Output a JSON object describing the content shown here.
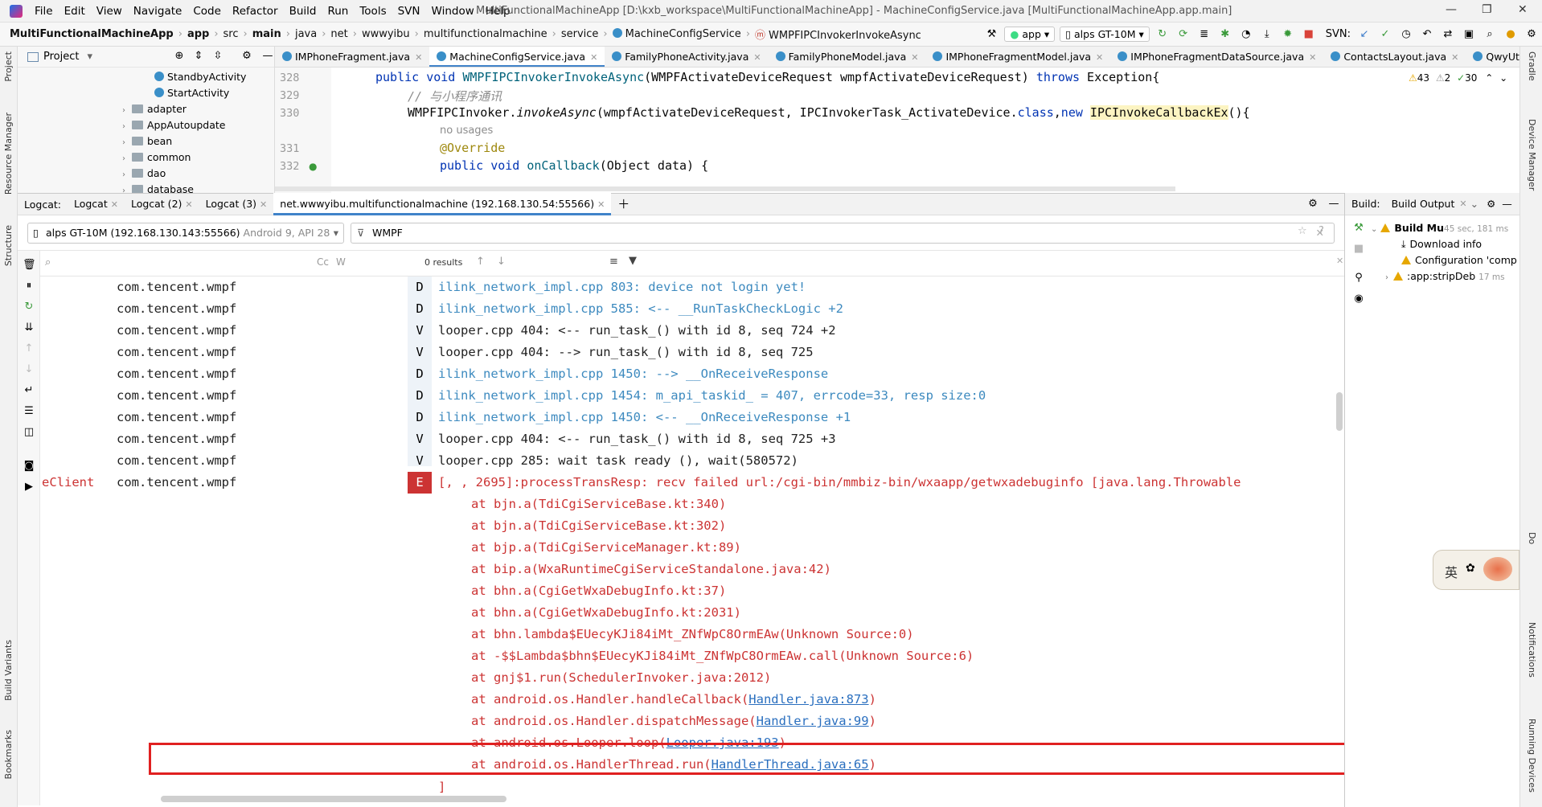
{
  "menubar": {
    "items": [
      "File",
      "Edit",
      "View",
      "Navigate",
      "Code",
      "Refactor",
      "Build",
      "Run",
      "Tools",
      "SVN",
      "Window",
      "Help"
    ],
    "window_title": "MultiFunctionalMachineApp [D:\\kxb_workspace\\MultiFunctionalMachineApp] - MachineConfigService.java [MultiFunctionalMachineApp.app.main]"
  },
  "navbar": {
    "crumbs": [
      "MultiFunctionalMachineApp",
      "app",
      "src",
      "main",
      "java",
      "net",
      "wwwyibu",
      "multifunctionalmachine",
      "service",
      "MachineConfigService",
      "WMPFIPCInvokerInvokeAsync"
    ],
    "run_config": "app",
    "device": "alps GT-10M",
    "svn_label": "SVN:"
  },
  "project": {
    "title": "Project",
    "items": [
      {
        "label": "StandbyActivity",
        "type": "class"
      },
      {
        "label": "StartActivity",
        "type": "class"
      },
      {
        "label": "adapter",
        "type": "folder"
      },
      {
        "label": "AppAutoupdate",
        "type": "folder"
      },
      {
        "label": "bean",
        "type": "folder"
      },
      {
        "label": "common",
        "type": "folder"
      },
      {
        "label": "dao",
        "type": "folder"
      },
      {
        "label": "database",
        "type": "folder"
      }
    ]
  },
  "editor_tabs": [
    "IMPhoneFragment.java",
    "MachineConfigService.java",
    "FamilyPhoneActivity.java",
    "FamilyPhoneModel.java",
    "IMPhoneFragmentModel.java",
    "IMPhoneFragmentDataSource.java",
    "ContactsLayout.java",
    "QwyUtil.java"
  ],
  "editor": {
    "lines": [
      "328",
      "329",
      "330",
      "331",
      "332"
    ],
    "inspections": {
      "warnings": "43",
      "weak": "2",
      "ok": "30"
    },
    "code_lines": {
      "l1_a": "public void ",
      "l1_b": "WMPFIPCInvokerInvokeAsync",
      "l1_c": "(WMPFActivateDeviceRequest wmpfActivateDeviceRequest) ",
      "l1_d": "throws",
      "l1_e": " Exception{",
      "l2": "// 与小程序通讯",
      "l3_a": "WMPFIPCInvoker.",
      "l3_b": "invokeAsync",
      "l3_c": "(wmpfActivateDeviceRequest, IPCInvokerTask_ActivateDevice.",
      "l3_d": "class",
      "l3_e": ",",
      "l3_f": "new ",
      "l3_g": "IPCInvokeCallbackEx",
      "l3_h": "(){",
      "hint": "no usages",
      "l4": "@Override",
      "l5_a": "public void ",
      "l5_b": "onCallback",
      "l5_c": "(Object data) {"
    }
  },
  "logcat": {
    "label": "Logcat:",
    "tabs": [
      "Logcat",
      "Logcat (2)",
      "Logcat (3)",
      "net.wwwyibu.multifunctionalmachine (192.168.130.54:55566)"
    ],
    "device": "alps GT-10M (192.168.130.143:55566)",
    "device_suffix": "Android 9, API 28",
    "filter": "WMPF",
    "results": "0 results",
    "lines": [
      {
        "tag": "com.tencent.wmpf",
        "level": "D",
        "msg": "ilink_network_impl.cpp 803: device not login yet!"
      },
      {
        "tag": "com.tencent.wmpf",
        "level": "D",
        "msg": "ilink_network_impl.cpp 585: <-- __RunTaskCheckLogic +2"
      },
      {
        "tag": "com.tencent.wmpf",
        "level": "V",
        "msg": "looper.cpp 404: <-- run_task_() with id 8, seq 724 +2"
      },
      {
        "tag": "com.tencent.wmpf",
        "level": "V",
        "msg": "looper.cpp 404: --> run_task_() with id 8, seq 725"
      },
      {
        "tag": "com.tencent.wmpf",
        "level": "D",
        "msg": "ilink_network_impl.cpp 1450: --> __OnReceiveResponse"
      },
      {
        "tag": "com.tencent.wmpf",
        "level": "D",
        "msg": "ilink_network_impl.cpp 1454: m_api_taskid_ = 407, errcode=33, resp size:0"
      },
      {
        "tag": "com.tencent.wmpf",
        "level": "D",
        "msg": "ilink_network_impl.cpp 1450: <-- __OnReceiveResponse +1"
      },
      {
        "tag": "com.tencent.wmpf",
        "level": "V",
        "msg": "looper.cpp 404: <-- run_task_() with id 8, seq 725 +3"
      },
      {
        "tag": "com.tencent.wmpf",
        "level": "V",
        "msg": "looper.cpp 285: wait task ready (), wait(580572)"
      },
      {
        "prefix": "eClient",
        "tag": "com.tencent.wmpf",
        "level": "E",
        "msg": "[, , 2695]:processTransResp: recv failed url:/cgi-bin/mmbiz-bin/wxaapp/getwxadebuginfo [java.lang.Throwable"
      }
    ],
    "trace": [
      {
        "text": "at bjn.a(TdiCgiServiceBase.kt:340)"
      },
      {
        "text": "at bjn.a(TdiCgiServiceBase.kt:302)"
      },
      {
        "text": "at bjp.a(TdiCgiServiceManager.kt:89)"
      },
      {
        "text": "at bip.a(WxaRuntimeCgiServiceStandalone.java:42)"
      },
      {
        "text": "at bhn.a(CgiGetWxaDebugInfo.kt:37)"
      },
      {
        "text": "at bhn.a(CgiGetWxaDebugInfo.kt:2031)"
      },
      {
        "text": "at bhn.lambda$EUecyKJi84iMt_ZNfWpC8OrmEAw(Unknown Source:0)"
      },
      {
        "text": "at -$$Lambda$bhn$EUecyKJi84iMt_ZNfWpC8OrmEAw.call(Unknown Source:6)"
      },
      {
        "text": "at gnj$1.run(SchedulerInvoker.java:2012)"
      },
      {
        "pre": "at android.os.Handler.handleCallback(",
        "link": "Handler.java:873",
        "post": ")"
      },
      {
        "pre": "at android.os.Handler.dispatchMessage(",
        "link": "Handler.java:99",
        "post": ")"
      },
      {
        "pre": "at android.os.Looper.loop(",
        "link": "Looper.java:193",
        "post": ")"
      },
      {
        "pre": "at android.os.HandlerThread.run(",
        "link": "HandlerThread.java:65",
        "post": ")"
      }
    ],
    "close_bracket": "]"
  },
  "build": {
    "label": "Build:",
    "tab": "Build Output",
    "items": [
      {
        "text": "Build Mu",
        "time": "45 sec, 181 ms"
      },
      {
        "text": "Download info",
        "time": ""
      },
      {
        "text": "Configuration 'comp",
        "time": ""
      },
      {
        "text": ":app:stripDeb",
        "time": "17 ms"
      }
    ]
  },
  "side": {
    "left": [
      "Project",
      "Resource Manager",
      "Structure",
      "Build Variants",
      "Bookmarks"
    ],
    "right": [
      "Gradle",
      "Device Manager",
      "Do",
      "Notifications",
      "Running Devices"
    ]
  },
  "widget": {
    "text": "英"
  },
  "colors": {
    "accent": "#4083c9",
    "error": "#cc3333",
    "debug": "#3d8abf",
    "highlight_box": "#e02020"
  }
}
